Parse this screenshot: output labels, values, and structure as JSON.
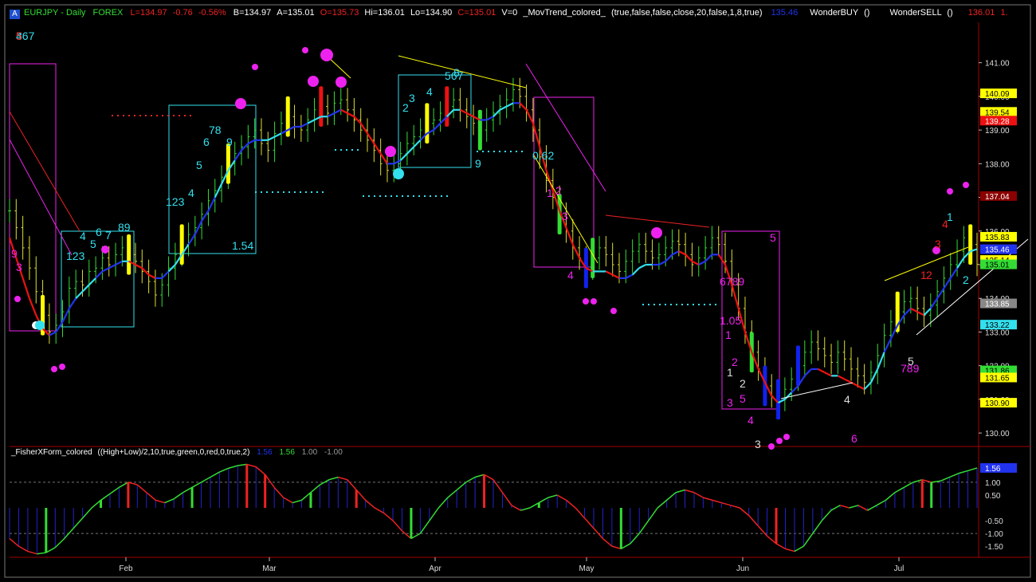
{
  "header": {
    "badge": "A",
    "symbol": "EURJPY - Daily",
    "market": "FOREX",
    "last": "L=134.97",
    "change": "-0.76",
    "change_pct": "-0.56%",
    "bid": "B=134.97",
    "ask": "A=135.01",
    "open": "O=135.73",
    "high": "Hi=136.01",
    "low": "Lo=134.90",
    "close": "C=135.01",
    "volume": "V=0",
    "indicator1": "_MovTrend_colored_",
    "indicator1_params": "(true,false,false,close,20,false,1,8,true)",
    "indicator1_value": "135.46",
    "indicator2": "WonderBUY",
    "indicator2_params": "()",
    "indicator3": "WonderSELL",
    "indicator3_params": "()",
    "indicator3_value": "136.01",
    "indicator3_extra": "1."
  },
  "sub_header": {
    "name": "_FisherXForm_colored",
    "params": "((High+Low)/2,10,true,green,0,red,0,true,2)",
    "v1": "1.56",
    "v2": "1.56",
    "v3": "1.00",
    "v4": "-1.00"
  },
  "colors": {
    "background": "#000000",
    "grid": "#a00000",
    "up_bar": "#33dd33",
    "down_bar": "#dddd33",
    "blue_line": "#2233ee",
    "cyan_line": "#33e0ee",
    "red_line": "#ee1111",
    "magenta": "#ee22ee",
    "fisher_up": "#33dd33",
    "fisher_down": "#ee2222",
    "histogram": "#2222cc"
  },
  "chart_data": [
    {
      "type": "candlestick",
      "title": "EURJPY - Daily",
      "x_ticks": [
        "Feb",
        "Mar",
        "Apr",
        "May",
        "Jun",
        "Jul"
      ],
      "y_ticks": [
        "130.00",
        "131.00",
        "132.00",
        "133.00",
        "134.00",
        "135.00",
        "136.00",
        "137.00",
        "138.00",
        "139.00",
        "140.00",
        "141.00"
      ],
      "ylim": [
        129.6,
        142.2
      ],
      "price_tags": [
        {
          "label": "140.09",
          "value": 140.09,
          "color": "#ffff00"
        },
        {
          "label": "139.54",
          "value": 139.54,
          "color": "#ffff00"
        },
        {
          "label": "139.28",
          "value": 139.28,
          "color": "#ee1111"
        },
        {
          "label": "137.04",
          "value": 137.04,
          "color": "#8b0000"
        },
        {
          "label": "135.83",
          "value": 135.83,
          "color": "#ffff00"
        },
        {
          "label": "135.46",
          "value": 135.46,
          "color": "#2233ee"
        },
        {
          "label": "135.14",
          "value": 135.14,
          "color": "#ffff00"
        },
        {
          "label": "135.01",
          "value": 135.01,
          "color": "#33dd33"
        },
        {
          "label": "133.85",
          "value": 133.85,
          "color": "#888888"
        },
        {
          "label": "133.22",
          "value": 133.22,
          "color": "#33e0ee"
        },
        {
          "label": "131.86",
          "value": 131.86,
          "color": "#33dd33"
        },
        {
          "label": "131.65",
          "value": 131.65,
          "color": "#ffff00"
        },
        {
          "label": "130.90",
          "value": 130.9,
          "color": "#ffff00"
        }
      ],
      "closes": [
        136.6,
        136.1,
        135.5,
        134.9,
        134.2,
        133.5,
        133.0,
        133.2,
        133.6,
        134.3,
        134.5,
        134.4,
        134.8,
        134.9,
        135.2,
        135.0,
        135.3,
        135.5,
        135.3,
        135.1,
        134.8,
        134.5,
        134.1,
        134.4,
        134.9,
        135.3,
        135.6,
        135.9,
        136.1,
        136.5,
        136.9,
        137.2,
        137.6,
        138.0,
        138.3,
        138.5,
        138.8,
        139.0,
        138.6,
        138.4,
        138.9,
        139.2,
        139.4,
        139.1,
        139.0,
        139.3,
        139.6,
        139.7,
        139.5,
        139.8,
        139.9,
        139.6,
        139.3,
        139.0,
        138.7,
        138.4,
        138.0,
        137.8,
        138.0,
        138.3,
        138.6,
        138.8,
        139.0,
        139.2,
        139.3,
        139.5,
        139.7,
        139.9,
        139.6,
        139.4,
        139.2,
        139.0,
        139.3,
        139.5,
        139.7,
        139.9,
        140.2,
        140.0,
        139.6,
        139.0,
        138.2,
        137.5,
        137.0,
        136.5,
        136.0,
        135.5,
        135.2,
        134.9,
        135.2,
        135.5,
        135.3,
        135.0,
        134.8,
        135.1,
        135.4,
        135.6,
        135.4,
        135.2,
        135.3,
        135.5,
        135.7,
        135.6,
        135.3,
        135.0,
        135.2,
        135.5,
        135.8,
        135.6,
        135.1,
        134.4,
        133.7,
        133.0,
        132.4,
        131.9,
        131.4,
        131.1,
        131.0,
        131.3,
        131.6,
        132.0,
        132.4,
        132.7,
        132.5,
        132.3,
        132.1,
        132.4,
        132.2,
        131.9,
        131.7,
        131.5,
        131.8,
        132.3,
        132.9,
        133.3,
        133.6,
        133.9,
        134.0,
        133.7,
        133.5,
        133.8,
        134.2,
        134.6,
        135.0,
        135.4,
        135.8,
        135.6,
        135.01
      ],
      "ma_values": [
        135.8,
        135.2,
        134.6,
        134.0,
        133.5,
        133.1,
        132.9,
        133.0,
        133.3,
        133.7,
        134.0,
        134.2,
        134.4,
        134.6,
        134.8,
        134.9,
        135.0,
        135.1,
        135.1,
        135.0,
        134.9,
        134.7,
        134.6,
        134.6,
        134.8,
        135.0,
        135.3,
        135.6,
        135.9,
        136.3,
        136.6,
        137.0,
        137.4,
        137.8,
        138.1,
        138.4,
        138.6,
        138.7,
        138.7,
        138.7,
        138.8,
        138.9,
        139.0,
        139.1,
        139.1,
        139.2,
        139.3,
        139.4,
        139.4,
        139.5,
        139.6,
        139.5,
        139.4,
        139.2,
        138.9,
        138.6,
        138.3,
        138.0,
        138.0,
        138.1,
        138.3,
        138.5,
        138.7,
        138.9,
        139.0,
        139.2,
        139.4,
        139.6,
        139.6,
        139.5,
        139.4,
        139.3,
        139.3,
        139.4,
        139.6,
        139.7,
        139.8,
        139.8,
        139.6,
        139.2,
        138.5,
        137.8,
        137.2,
        136.6,
        136.1,
        135.6,
        135.2,
        134.9,
        134.8,
        134.8,
        134.8,
        134.7,
        134.6,
        134.6,
        134.7,
        134.9,
        135.0,
        135.0,
        135.0,
        135.1,
        135.3,
        135.4,
        135.3,
        135.1,
        135.0,
        135.1,
        135.3,
        135.3,
        135.0,
        134.4,
        133.7,
        133.0,
        132.4,
        131.9,
        131.5,
        131.1,
        130.9,
        131.0,
        131.2,
        131.4,
        131.7,
        131.9,
        131.9,
        131.8,
        131.7,
        131.7,
        131.6,
        131.5,
        131.4,
        131.3,
        131.5,
        131.9,
        132.4,
        132.8,
        133.2,
        133.5,
        133.7,
        133.6,
        133.5,
        133.7,
        134.0,
        134.3,
        134.6,
        134.9,
        135.2,
        135.4,
        135.46
      ],
      "sequence_labels": [
        {
          "text": "9",
          "color": "#ee22ee"
        },
        {
          "text": "3",
          "color": "#ee22ee"
        },
        {
          "text": "123",
          "color": "#33e0ee"
        },
        {
          "text": "4",
          "color": "#33e0ee"
        },
        {
          "text": "5",
          "color": "#33e0ee"
        },
        {
          "text": "6",
          "color": "#33e0ee"
        },
        {
          "text": "78",
          "color": "#33e0ee"
        },
        {
          "text": "9",
          "color": "#33e0ee"
        },
        {
          "text": "123",
          "color": "#33e0ee"
        },
        {
          "text": "4",
          "color": "#33e0ee"
        },
        {
          "text": "5",
          "color": "#33e0ee"
        },
        {
          "text": "6",
          "color": "#33e0ee"
        },
        {
          "text": "7",
          "color": "#33e0ee"
        },
        {
          "text": "89",
          "color": "#33e0ee"
        },
        {
          "text": "1.54",
          "color": "#33e0ee"
        },
        {
          "text": "2",
          "color": "#33e0ee"
        },
        {
          "text": "3",
          "color": "#33e0ee"
        },
        {
          "text": "4",
          "color": "#33e0ee"
        },
        {
          "text": "567",
          "color": "#33e0ee"
        },
        {
          "text": "8",
          "color": "#33e0ee"
        },
        {
          "text": "9",
          "color": "#33e0ee"
        },
        {
          "text": "0.62",
          "color": "#33e0ee"
        },
        {
          "text": "1",
          "color": "#ee22ee"
        },
        {
          "text": "2",
          "color": "#ee22ee"
        },
        {
          "text": "3",
          "color": "#ee22ee"
        },
        {
          "text": "4",
          "color": "#ee22ee"
        },
        {
          "text": "5",
          "color": "#ee22ee"
        },
        {
          "text": "6789",
          "color": "#ee22ee"
        },
        {
          "text": "1.05",
          "color": "#ee22ee"
        },
        {
          "text": "1",
          "color": "#ee22ee"
        },
        {
          "text": "1",
          "color": "#dddddd"
        },
        {
          "text": "2",
          "color": "#ee22ee"
        },
        {
          "text": "2",
          "color": "#dddddd"
        },
        {
          "text": "3",
          "color": "#ee22ee"
        },
        {
          "text": "4",
          "color": "#ee22ee"
        },
        {
          "text": "5",
          "color": "#ee22ee"
        },
        {
          "text": "3",
          "color": "#dddddd"
        },
        {
          "text": "4",
          "color": "#dddddd"
        },
        {
          "text": "6",
          "color": "#ee22ee"
        },
        {
          "text": "789",
          "color": "#ee22ee"
        },
        {
          "text": "5",
          "color": "#dddddd"
        },
        {
          "text": "1",
          "color": "#ee2222"
        },
        {
          "text": "2",
          "color": "#ee2222"
        },
        {
          "text": "3",
          "color": "#ee2222"
        },
        {
          "text": "4",
          "color": "#ee2222"
        },
        {
          "text": "1",
          "color": "#33e0ee"
        },
        {
          "text": "2",
          "color": "#33e0ee"
        },
        {
          "text": "3",
          "color": "#33e0ee"
        },
        {
          "text": "4",
          "color": "#33e0ee"
        },
        {
          "text": "567",
          "color": "#33e0ee"
        },
        {
          "text": "5",
          "color": "#ee2222"
        }
      ]
    },
    {
      "type": "line",
      "title": "_FisherXForm_colored",
      "y_ticks": [
        "1.00",
        "0.50",
        "-0.50",
        "-1.00",
        "-1.50"
      ],
      "ylim": [
        -1.9,
        1.9
      ],
      "value_tag": "1.56",
      "values": [
        -1.2,
        -1.5,
        -1.7,
        -1.8,
        -1.75,
        -1.55,
        -1.2,
        -0.8,
        -0.4,
        0.0,
        0.3,
        0.55,
        0.8,
        1.0,
        0.9,
        0.6,
        0.3,
        0.2,
        0.35,
        0.6,
        0.8,
        1.0,
        1.2,
        1.4,
        1.55,
        1.65,
        1.7,
        1.6,
        1.3,
        0.8,
        0.4,
        0.2,
        0.3,
        0.6,
        0.9,
        1.1,
        1.2,
        1.1,
        0.7,
        0.3,
        0.0,
        -0.2,
        -0.5,
        -0.9,
        -1.2,
        -1.0,
        -0.5,
        0.0,
        0.4,
        0.7,
        1.0,
        1.2,
        1.3,
        1.1,
        0.6,
        0.1,
        -0.1,
        0.0,
        0.2,
        0.4,
        0.5,
        0.3,
        0.0,
        -0.4,
        -0.8,
        -1.2,
        -1.5,
        -1.6,
        -1.4,
        -1.0,
        -0.5,
        0.0,
        0.3,
        0.6,
        0.7,
        0.6,
        0.4,
        0.3,
        0.2,
        0.1,
        0.0,
        -0.3,
        -0.7,
        -1.1,
        -1.4,
        -1.6,
        -1.7,
        -1.5,
        -1.0,
        -0.5,
        -0.1,
        0.1,
        0.0,
        0.1,
        -0.1,
        0.1,
        0.3,
        0.6,
        0.8,
        1.0,
        1.1,
        1.0,
        1.05,
        1.2,
        1.35,
        1.45,
        1.56
      ]
    }
  ]
}
